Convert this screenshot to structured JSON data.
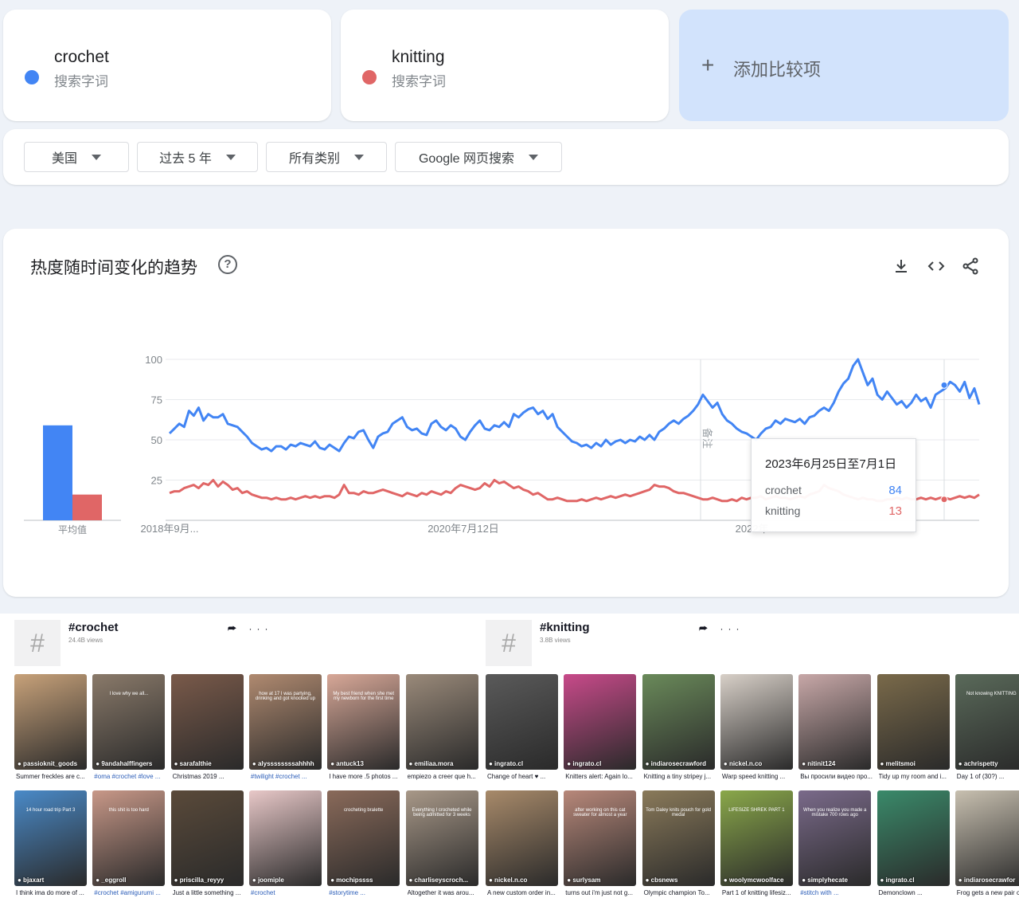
{
  "terms": [
    {
      "name": "crochet",
      "type": "搜索字词",
      "color": "#4285f4"
    },
    {
      "name": "knitting",
      "type": "搜索字词",
      "color": "#e06666"
    }
  ],
  "add_compare": {
    "icon": "plus-icon",
    "label": "添加比较项"
  },
  "filters": [
    {
      "label": "美国"
    },
    {
      "label": "过去 5 年"
    },
    {
      "label": "所有类别"
    },
    {
      "label": "Google 网页搜索"
    }
  ],
  "trend": {
    "title": "热度随时间变化的趋势",
    "help_icon": "?",
    "actions": [
      "download-icon",
      "embed-icon",
      "share-icon"
    ],
    "average_label": "平均值",
    "note_label": "备注",
    "tooltip": {
      "date": "2023年6月25日至7月1日",
      "rows": [
        {
          "name": "crochet",
          "value": "84"
        },
        {
          "name": "knitting",
          "value": "13"
        }
      ]
    }
  },
  "chart_data": {
    "type": "line",
    "y_ticks": [
      "100",
      "75",
      "50",
      "25"
    ],
    "x_ticks": [
      "2018年9月...",
      "2020年7月12日",
      "2022年..."
    ],
    "ylim": [
      0,
      100
    ],
    "averages": {
      "crochet": 59,
      "knitting": 16
    },
    "series": [
      {
        "name": "crochet",
        "color": "#4285f4",
        "values": [
          54,
          57,
          60,
          58,
          68,
          65,
          70,
          62,
          66,
          64,
          64,
          66,
          60,
          59,
          58,
          55,
          52,
          48,
          46,
          44,
          45,
          43,
          46,
          46,
          44,
          47,
          46,
          48,
          47,
          46,
          49,
          45,
          44,
          47,
          45,
          43,
          48,
          52,
          51,
          55,
          56,
          50,
          45,
          52,
          54,
          55,
          60,
          62,
          64,
          58,
          56,
          57,
          54,
          53,
          60,
          62,
          58,
          56,
          59,
          57,
          52,
          50,
          55,
          59,
          62,
          57,
          56,
          59,
          58,
          61,
          58,
          66,
          64,
          67,
          69,
          70,
          66,
          68,
          63,
          66,
          58,
          55,
          52,
          49,
          48,
          46,
          47,
          45,
          48,
          46,
          50,
          47,
          49,
          50,
          48,
          50,
          49,
          52,
          50,
          53,
          50,
          55,
          57,
          60,
          62,
          60,
          63,
          65,
          68,
          72,
          78,
          74,
          70,
          73,
          66,
          62,
          60,
          57,
          55,
          54,
          52,
          50,
          54,
          57,
          58,
          62,
          60,
          63,
          62,
          61,
          63,
          60,
          64,
          65,
          68,
          70,
          68,
          73,
          80,
          85,
          88,
          96,
          100,
          92,
          84,
          88,
          78,
          75,
          80,
          76,
          72,
          74,
          70,
          73,
          78,
          74,
          76,
          70,
          78,
          80,
          82,
          86,
          84,
          80,
          86,
          76,
          82,
          72
        ]
      },
      {
        "name": "knitting",
        "color": "#e06666",
        "values": [
          17,
          18,
          18,
          20,
          21,
          22,
          20,
          23,
          22,
          25,
          21,
          24,
          22,
          19,
          20,
          17,
          18,
          16,
          15,
          14,
          14,
          13,
          14,
          13,
          13,
          14,
          13,
          14,
          15,
          14,
          15,
          14,
          15,
          15,
          14,
          16,
          22,
          17,
          17,
          16,
          18,
          17,
          17,
          18,
          19,
          18,
          17,
          16,
          15,
          17,
          16,
          15,
          17,
          16,
          18,
          17,
          16,
          18,
          17,
          20,
          22,
          21,
          20,
          19,
          20,
          23,
          21,
          25,
          23,
          24,
          22,
          20,
          21,
          19,
          18,
          16,
          17,
          15,
          13,
          13,
          14,
          13,
          12,
          12,
          12,
          13,
          12,
          13,
          14,
          13,
          14,
          15,
          14,
          15,
          16,
          15,
          16,
          17,
          18,
          19,
          22,
          21,
          21,
          20,
          18,
          17,
          17,
          16,
          15,
          14,
          13,
          13,
          14,
          13,
          12,
          12,
          13,
          12,
          14,
          13,
          14,
          14,
          15,
          13,
          14,
          15,
          14,
          14,
          13,
          14,
          15,
          14,
          16,
          17,
          18,
          22,
          20,
          19,
          18,
          16,
          15,
          14,
          13,
          14,
          13,
          13,
          12,
          12,
          13,
          13,
          14,
          13,
          14,
          13,
          13,
          14,
          13,
          14,
          13,
          14,
          14,
          13,
          14,
          15,
          14,
          15,
          14,
          16
        ]
      }
    ]
  },
  "tiktok": [
    {
      "tag": "#crochet",
      "views": "24.4B views",
      "icons": "⮫ ···",
      "videos": [
        {
          "user": "passioknit_goods",
          "caption": "Summer freckles are c...",
          "tag": false,
          "color": "#c8a27a",
          "overlay": ""
        },
        {
          "user": "9andahalffingers",
          "caption": "#oma #crochet #love ...",
          "tag": true,
          "color": "#8a7a6a",
          "overlay": "I love why we all..."
        },
        {
          "user": "sarafalthie",
          "caption": "Christmas 2019 ...",
          "tag": false,
          "color": "#7a5a4a",
          "overlay": ""
        },
        {
          "user": "alyssssssssahhhh",
          "caption": "#twilight #crochet ...",
          "tag": true,
          "color": "#b08a70",
          "overlay": "how at 17 I was partying, drinking and got knocked up"
        },
        {
          "user": "antuck13",
          "caption": "I have more .5 photos ...",
          "tag": false,
          "color": "#d8a898",
          "overlay": "My best friend when she met my newborn for the first time"
        },
        {
          "user": "emiliaa.mora",
          "caption": "empiezo a creer que h...",
          "tag": false,
          "color": "#9a8a7a",
          "overlay": ""
        },
        {
          "user": "bjaxart",
          "caption": "I think ima do more of ...",
          "tag": false,
          "color": "#4a8ac8",
          "overlay": "14 hour road trip Part 3"
        },
        {
          "user": "_eggroll",
          "caption": "#crochet #amigurumi ...",
          "tag": true,
          "color": "#c89888",
          "overlay": "this shit is too hard"
        },
        {
          "user": "priscilla_reyyy",
          "caption": "Just a little something ...",
          "tag": false,
          "color": "#5a4a3a",
          "overlay": ""
        },
        {
          "user": "joomiple",
          "caption": "#crochet",
          "tag": true,
          "color": "#e8c8c8",
          "overlay": ""
        },
        {
          "user": "mochipssss",
          "caption": "#storytime ...",
          "tag": true,
          "color": "#8a6a5a",
          "overlay": "crocheting bralette"
        },
        {
          "user": "charliseyscroch...",
          "caption": "Altogether it was arou...",
          "tag": false,
          "color": "#a89888",
          "overlay": "Everything I crocheted while being admitted for 3 weeks"
        }
      ]
    },
    {
      "tag": "#knitting",
      "views": "3.8B views",
      "icons": "⮫ ···",
      "videos": [
        {
          "user": "ingrato.cl",
          "caption": "Change of heart ♥ ...",
          "tag": false,
          "color": "#5a5a5a",
          "overlay": ""
        },
        {
          "user": "ingrato.cl",
          "caption": "Knitters alert: Again lo...",
          "tag": false,
          "color": "#c84a8a",
          "overlay": ""
        },
        {
          "user": "indiarosecrawford",
          "caption": "Knitting a tiny stripey j...",
          "tag": false,
          "color": "#6a8a5a",
          "overlay": ""
        },
        {
          "user": "nickel.n.co",
          "caption": "Warp speed knitting ...",
          "tag": false,
          "color": "#d8d0c8",
          "overlay": ""
        },
        {
          "user": "nitinit124",
          "caption": "Вы просили видео про...",
          "tag": false,
          "color": "#c8a8a8",
          "overlay": ""
        },
        {
          "user": "melitsmoi",
          "caption": "Tidy up my room and i...",
          "tag": false,
          "color": "#7a6a4a",
          "overlay": ""
        },
        {
          "user": "achrispetty",
          "caption": "Day 1 of (30?) ...",
          "tag": false,
          "color": "#5a6a5a",
          "overlay": "Not knowing KNITTING"
        },
        {
          "user": "nickel.n.co",
          "caption": "A new custom order in...",
          "tag": false,
          "color": "#a88a6a",
          "overlay": ""
        },
        {
          "user": "surlysam",
          "caption": "turns out i'm just not g...",
          "tag": false,
          "color": "#b8887a",
          "overlay": "after working on this cat sweater for almost a year"
        },
        {
          "user": "cbsnews",
          "caption": "Olympic champion To...",
          "tag": false,
          "color": "#8a7a5a",
          "overlay": "Tom Daley knits pouch for gold medal"
        },
        {
          "user": "woolymcwoolface",
          "caption": "Part 1 of knitting lifesiz...",
          "tag": false,
          "color": "#8aa84a",
          "overlay": "LIFESIZE SHREK PART 1"
        },
        {
          "user": "simplyhecate",
          "caption": "#stitch with ...",
          "tag": true,
          "color": "#7a6a8a",
          "overlay": "When you realize you made a mistake 700 rows ago"
        },
        {
          "user": "ingrato.cl",
          "caption": "Demonclown ...",
          "tag": false,
          "color": "#3a8a6a",
          "overlay": ""
        },
        {
          "user": "indiarosecrawfor",
          "caption": "Frog gets a new pair o...",
          "tag": false,
          "color": "#c8c0b0",
          "overlay": ""
        }
      ]
    }
  ]
}
